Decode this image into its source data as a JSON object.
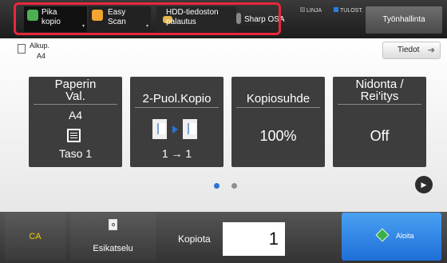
{
  "topbar": {
    "pika_kopio": "Pika\nkopio",
    "easy_scan": "Easy\nScan",
    "hdd": "HDD-tiedoston\npalautus",
    "sharp_osa": "Sharp OSA",
    "status_linja": "LINJA",
    "status_tulost": "TULOST.",
    "tyonhallinta": "Työnhallinta"
  },
  "original": {
    "label": "Alkup.",
    "value": "A4"
  },
  "tiedot": "Tiedot",
  "tiles": {
    "paperi": {
      "title": "Paperin\nVal.",
      "size": "A4",
      "tray": "Taso 1"
    },
    "duplex": {
      "title": "2-Puol.Kopio",
      "value": "1 → 1"
    },
    "kopiosuhde": {
      "title": "Kopiosuhde",
      "value": "100%"
    },
    "nidonta": {
      "title": "Nidonta /\nRei'itys",
      "value": "Off"
    }
  },
  "bottom": {
    "ca": "CA",
    "esikatselu": "Esikatselu",
    "kopiota": "Kopiota",
    "copies": "1",
    "aloita": "Aloita"
  },
  "colors": {
    "accent_blue": "#1e6fd8",
    "highlight_red": "#e8283c",
    "ca_yellow": "#f5d000"
  },
  "page_indicator": {
    "current": 1,
    "total": 2
  }
}
